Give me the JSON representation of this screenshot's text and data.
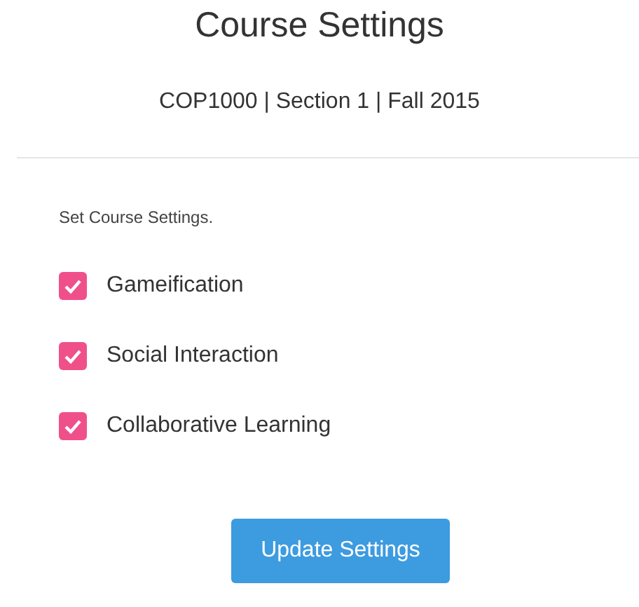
{
  "title": "Course Settings",
  "subtitle": "COP1000 | Section 1 | Fall 2015",
  "instructions": "Set Course Settings.",
  "options": [
    {
      "label": "Gameification",
      "checked": true
    },
    {
      "label": "Social Interaction",
      "checked": true
    },
    {
      "label": "Collaborative Learning",
      "checked": true
    }
  ],
  "button": "Update Settings"
}
